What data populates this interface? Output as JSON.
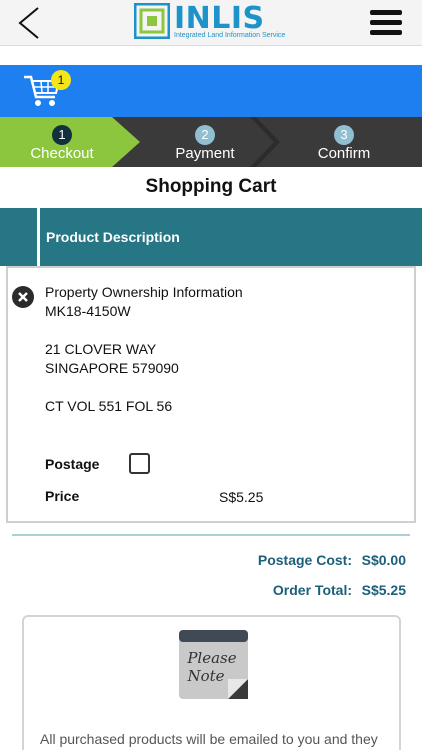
{
  "header": {
    "logo_text": "INLIS",
    "logo_subtitle": "Integrated Land Information Service",
    "back_icon": "chevron-left-icon",
    "menu_icon": "hamburger-menu-icon"
  },
  "cart": {
    "icon": "shopping-cart-icon",
    "count": "1"
  },
  "steps": [
    {
      "number": "1",
      "label": "Checkout",
      "state": "active"
    },
    {
      "number": "2",
      "label": "Payment",
      "state": "inactive"
    },
    {
      "number": "3",
      "label": "Confirm",
      "state": "inactive"
    }
  ],
  "page_title": "Shopping Cart",
  "table": {
    "column_header": "Product Description"
  },
  "product": {
    "name": "Property Ownership Information",
    "code": "MK18-4150W",
    "address_line1": "21 CLOVER WAY",
    "address_line2": "SINGAPORE 579090",
    "title_ref": "CT VOL 551 FOL 56",
    "postage_label": "Postage",
    "postage_checked": false,
    "price_label": "Price",
    "price_value": "S$5.25",
    "remove_icon": "remove-circle-x-icon"
  },
  "summary": {
    "postage_cost_label": "Postage Cost:",
    "postage_cost_value": "S$0.00",
    "order_total_label": "Order Total:",
    "order_total_value": "S$5.25"
  },
  "note": {
    "icon_line1": "Please",
    "icon_line2": "Note",
    "text": "All purchased products will be emailed to you and they"
  },
  "colors": {
    "brand_blue": "#1d93c9",
    "cart_bar": "#1e7ff0",
    "step_active": "#8cc63f",
    "step_inactive": "#3a3a3a",
    "table_header": "#267685",
    "summary_text": "#1c5f7a"
  }
}
